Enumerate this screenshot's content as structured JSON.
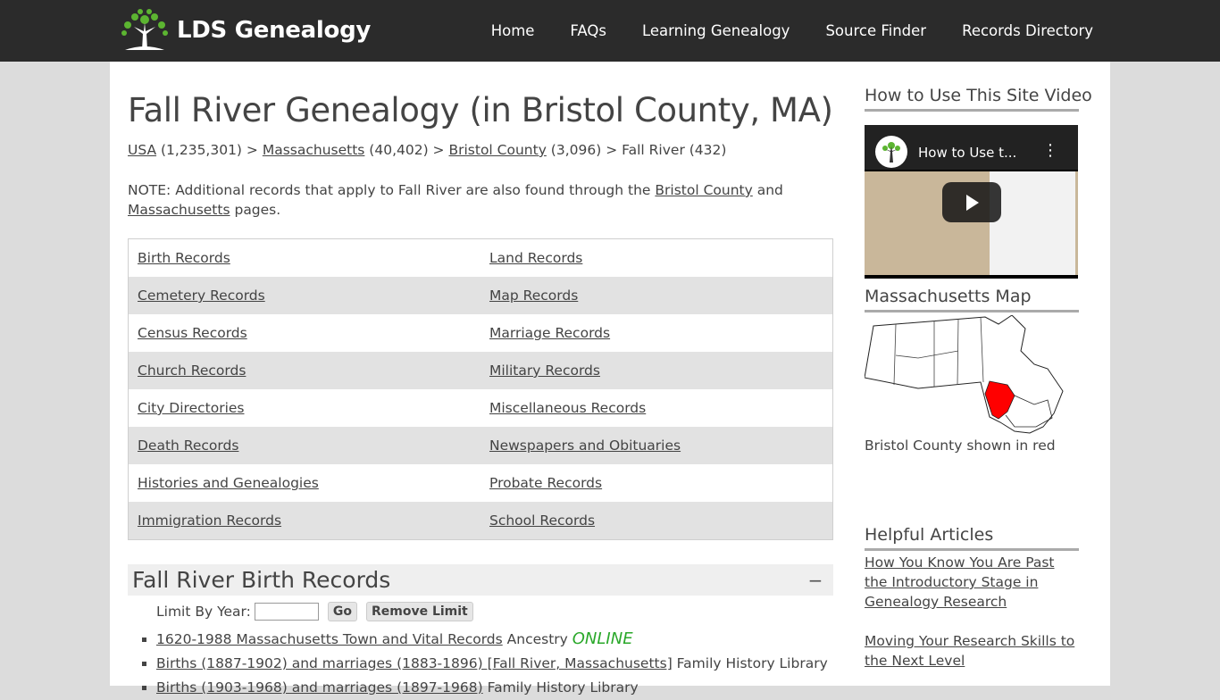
{
  "header": {
    "logo_text": "LDS Genealogy",
    "nav": [
      "Home",
      "FAQs",
      "Learning Genealogy",
      "Source Finder",
      "Records Directory"
    ]
  },
  "page_title": "Fall River Genealogy (in Bristol County, MA)",
  "breadcrumb": {
    "usa": "USA",
    "usa_count": " (1,235,301) > ",
    "ma": "Massachusetts",
    "ma_count": " (40,402) > ",
    "county": "Bristol County",
    "county_count": " (3,096) > ",
    "current": "Fall River (432)"
  },
  "note": {
    "prefix": "NOTE: Additional records that apply to Fall River are also found through the ",
    "link1": "Bristol County",
    "mid": " and ",
    "link2": "Massachusetts",
    "suffix": " pages."
  },
  "record_types": [
    [
      "Birth Records",
      "Land Records"
    ],
    [
      "Cemetery Records",
      "Map Records"
    ],
    [
      "Census Records",
      "Marriage Records"
    ],
    [
      "Church Records",
      "Military Records"
    ],
    [
      "City Directories",
      "Miscellaneous Records"
    ],
    [
      "Death Records",
      "Newspapers and Obituaries"
    ],
    [
      "Histories and Genealogies",
      "Probate Records"
    ],
    [
      "Immigration Records",
      "School Records"
    ]
  ],
  "section": {
    "title": "Fall River Birth Records",
    "collapse_symbol": "−",
    "limit_label": "Limit By Year:",
    "go": "Go",
    "remove": "Remove Limit",
    "items": [
      {
        "link": "1620-1988 Massachusetts Town and Vital Records",
        "source": " Ancestry ",
        "online": "ONLINE"
      },
      {
        "link": "Births (1887-1902) and marriages (1883-1896) [Fall River, Massachusetts]",
        "source": " Family History Library",
        "online": ""
      },
      {
        "link": "Births (1903-1968) and marriages (1897-1968)",
        "source": " Family History Library",
        "online": ""
      }
    ]
  },
  "sidebar": {
    "video_heading": "How to Use This Site Video",
    "video_title": "How to Use t...",
    "map_heading": "Massachusetts Map",
    "map_caption": "Bristol County shown in red",
    "articles_heading": "Helpful Articles",
    "articles": [
      "How You Know You Are Past the Introductory Stage in Genealogy Research",
      "Moving Your Research Skills to the Next Level"
    ]
  },
  "colors": {
    "header_bg": "#2b2b2b",
    "online_green": "#2aa82a",
    "highlight_red": "#ff0000"
  }
}
